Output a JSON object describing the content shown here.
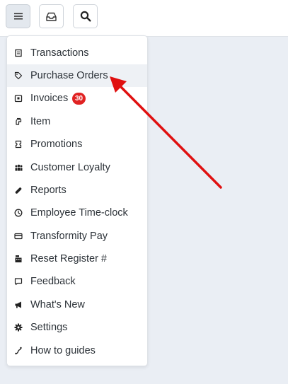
{
  "toolbar": {
    "menu_icon": "hamburger-icon",
    "inbox_icon": "inbox-icon",
    "search_icon": "search-icon"
  },
  "menu": {
    "items": [
      {
        "label": "Transactions",
        "icon": "receipt-icon"
      },
      {
        "label": "Purchase Orders",
        "icon": "tag-icon"
      },
      {
        "label": "Invoices",
        "icon": "invoice-icon",
        "badge": "30"
      },
      {
        "label": "Item",
        "icon": "hand-icon"
      },
      {
        "label": "Promotions",
        "icon": "ticket-icon"
      },
      {
        "label": "Customer Loyalty",
        "icon": "people-icon"
      },
      {
        "label": "Reports",
        "icon": "paperclip-icon"
      },
      {
        "label": "Employee Time-clock",
        "icon": "clock-icon"
      },
      {
        "label": "Transformity Pay",
        "icon": "credit-card-icon"
      },
      {
        "label": "Reset Register #",
        "icon": "cash-register-icon"
      },
      {
        "label": "Feedback",
        "icon": "comment-icon"
      },
      {
        "label": "What's New",
        "icon": "megaphone-icon"
      },
      {
        "label": "Settings",
        "icon": "gear-icon"
      },
      {
        "label": "How to guides",
        "icon": "route-icon"
      }
    ]
  },
  "colors": {
    "badge": "#e02222",
    "annotation_arrow": "#e01010",
    "hover_row": "#eef1f5",
    "background": "#eaeef4"
  }
}
